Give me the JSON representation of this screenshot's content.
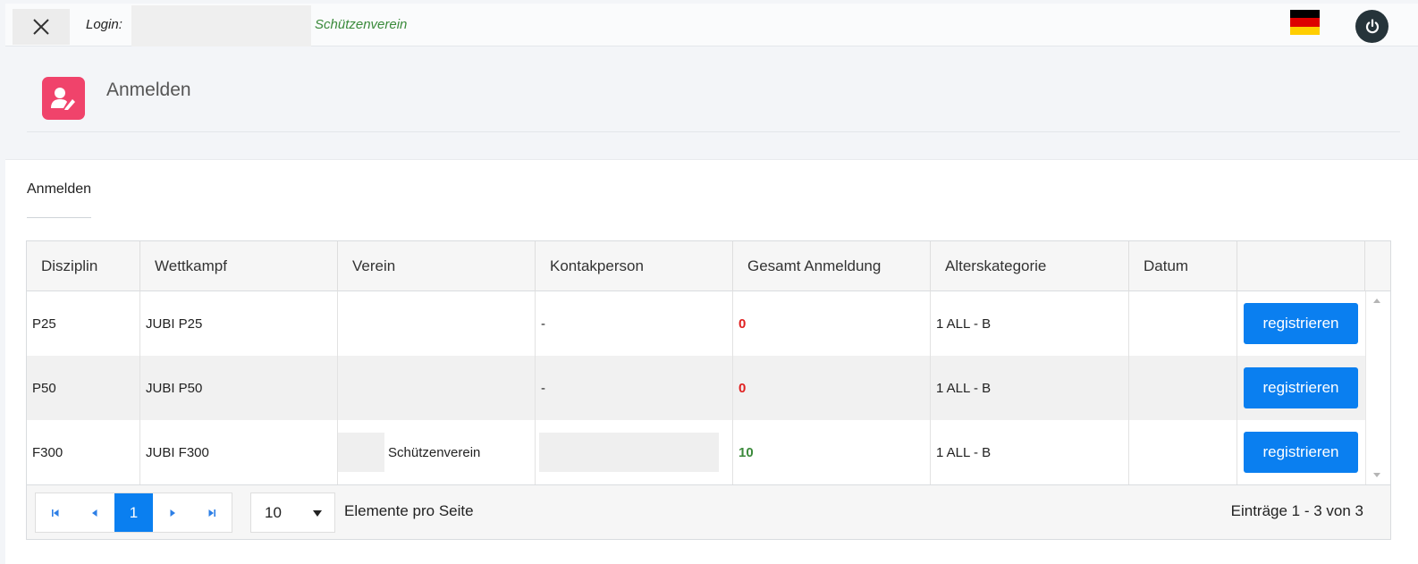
{
  "topbar": {
    "login_label": "Login:",
    "club_name": "Schützenverein",
    "flag_colors": [
      "#000000",
      "#DD0000",
      "#FFCE00"
    ]
  },
  "page": {
    "title": "Anmelden"
  },
  "card": {
    "title": "Anmelden"
  },
  "table": {
    "columns": [
      "Disziplin",
      "Wettkampf",
      "Verein",
      "Kontakperson",
      "Gesamt Anmeldung",
      "Alterskategorie",
      "Datum",
      ""
    ],
    "rows": [
      {
        "disziplin": "P25",
        "wettkampf": "JUBI P25",
        "verein": "",
        "kontakperson": "-",
        "gesamt": "0",
        "alterskategorie": "1 ALL - B",
        "datum": "",
        "action": "registrieren"
      },
      {
        "disziplin": "P50",
        "wettkampf": "JUBI P50",
        "verein": "",
        "kontakperson": "-",
        "gesamt": "0",
        "alterskategorie": "1 ALL - B",
        "datum": "",
        "action": "registrieren"
      },
      {
        "disziplin": "F300",
        "wettkampf": "JUBI F300",
        "verein": "Schützenverein",
        "kontakperson": "",
        "gesamt": "10",
        "alterskategorie": "1 ALL - B",
        "datum": "",
        "action": "registrieren"
      }
    ]
  },
  "pager": {
    "current_page": "1",
    "page_size": "10",
    "page_size_label": "Elemente pro Seite",
    "info": "Einträge 1 - 3 von 3"
  },
  "colors": {
    "accent": "#0a7ff0",
    "page_icon": "#f0436b",
    "zero_count": "#e02020",
    "positive_count": "#3b8a3b"
  }
}
